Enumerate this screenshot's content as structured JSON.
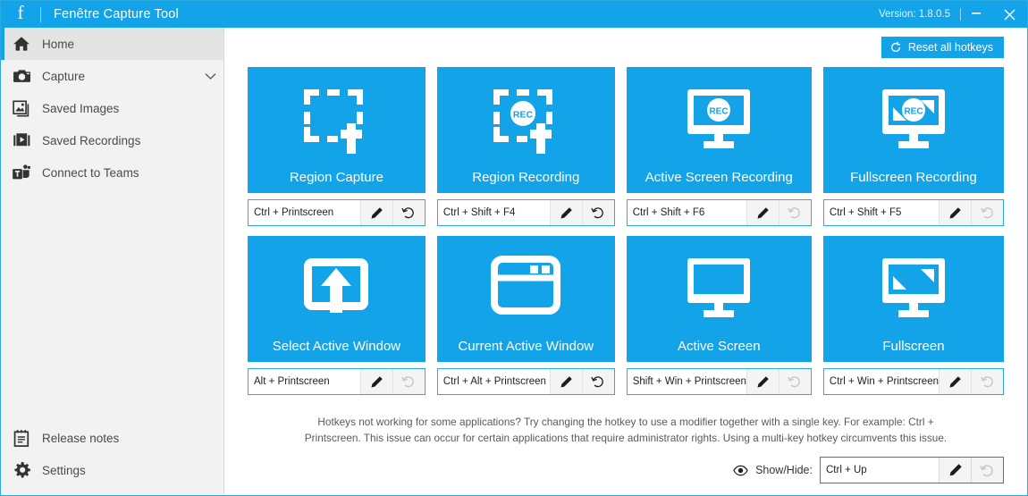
{
  "titlebar": {
    "logo": "f",
    "app_title": "Fenêtre Capture Tool",
    "version_label": "Version: 1.8.0.5",
    "minimize_glyph": "—",
    "close_glyph": "✕",
    "bg_color": "#13a3e8"
  },
  "sidebar": {
    "top_items": [
      {
        "label": "Home",
        "icon": "home-icon",
        "active": true,
        "has_chevron": false
      },
      {
        "label": "Capture",
        "icon": "camera-icon",
        "active": false,
        "has_chevron": true
      },
      {
        "label": "Saved Images",
        "icon": "images-icon",
        "active": false,
        "has_chevron": false
      },
      {
        "label": "Saved Recordings",
        "icon": "video-library-icon",
        "active": false,
        "has_chevron": false
      },
      {
        "label": "Connect to Teams",
        "icon": "teams-icon",
        "active": false,
        "has_chevron": false
      }
    ],
    "bottom_items": [
      {
        "label": "Release notes",
        "icon": "notepad-icon"
      },
      {
        "label": "Settings",
        "icon": "gear-icon"
      }
    ]
  },
  "toolbar": {
    "reset_all_label": "Reset all hotkeys",
    "reset_icon": "refresh-icon"
  },
  "tiles": [
    {
      "label": "Region Capture",
      "icon": "region-capture-icon",
      "hotkey": "Ctrl + Printscreen",
      "edit_icon": "pencil-icon",
      "reset_icon": "undo-icon",
      "reset_enabled": true
    },
    {
      "label": "Region Recording",
      "icon": "region-recording-icon",
      "hotkey": "Ctrl + Shift + F4",
      "edit_icon": "pencil-icon",
      "reset_icon": "undo-icon",
      "reset_enabled": true
    },
    {
      "label": "Active Screen Recording",
      "icon": "monitor-rec-icon",
      "hotkey": "Ctrl + Shift + F6",
      "edit_icon": "pencil-icon",
      "reset_icon": "undo-icon",
      "reset_enabled": false
    },
    {
      "label": "Fullscreen Recording",
      "icon": "fullscreen-rec-icon",
      "hotkey": "Ctrl + Shift + F5",
      "edit_icon": "pencil-icon",
      "reset_icon": "undo-icon",
      "reset_enabled": false
    },
    {
      "label": "Select Active Window",
      "icon": "select-window-icon",
      "hotkey": "Alt + Printscreen",
      "edit_icon": "pencil-icon",
      "reset_icon": "undo-icon",
      "reset_enabled": false
    },
    {
      "label": "Current Active Window",
      "icon": "window-icon",
      "hotkey": "Ctrl + Alt + Printscreen",
      "edit_icon": "pencil-icon",
      "reset_icon": "undo-icon",
      "reset_enabled": true
    },
    {
      "label": "Active Screen",
      "icon": "monitor-icon",
      "hotkey": "Shift + Win + Printscreen",
      "edit_icon": "pencil-icon",
      "reset_icon": "undo-icon",
      "reset_enabled": false
    },
    {
      "label": "Fullscreen",
      "icon": "fullscreen-icon",
      "hotkey": "Ctrl + Win + Printscreen",
      "edit_icon": "pencil-icon",
      "reset_icon": "undo-icon",
      "reset_enabled": false
    }
  ],
  "help_text": "Hotkeys not working for some applications? Try changing the hotkey to use a modifier together with a single key. For example: Ctrl + Printscreen. This issue can occur for certain applications that require administrator rights. Using a multi-key hotkey circumvents this issue.",
  "showhide": {
    "icon": "eye-icon",
    "label": "Show/Hide:",
    "value": "Ctrl + Up",
    "edit_icon": "pencil-icon",
    "reset_icon": "undo-icon",
    "reset_enabled": false
  },
  "colors": {
    "accent": "#13a3e8",
    "sidebar_bg": "#f2f2f2",
    "sidebar_active_bg": "#e4e4e4"
  }
}
